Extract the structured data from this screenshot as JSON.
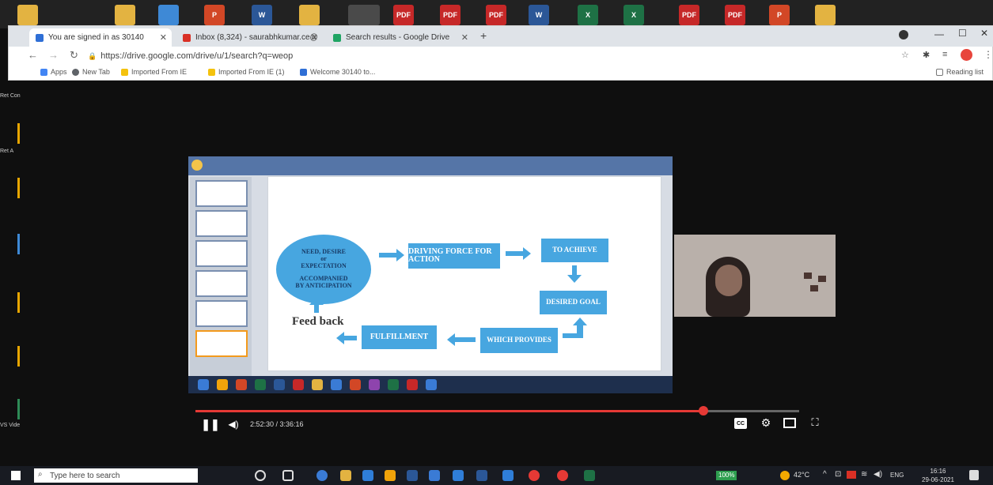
{
  "desktop": {
    "left_icons": [
      {
        "label": "Ret Con"
      },
      {
        "label": "Ret A"
      },
      {
        "label": "VS Vide"
      }
    ]
  },
  "browser": {
    "tabs": [
      {
        "title": "You are signed in as 30140",
        "favicon": "blue-square-icon",
        "color": "#2f6fd6"
      },
      {
        "title": "Inbox (8,324) - saurabhkumar.ce@",
        "favicon": "gmail-icon",
        "color": "#d93025"
      },
      {
        "title": "Search results - Google Drive",
        "favicon": "google-drive-icon",
        "color": "#1fa463"
      }
    ],
    "new_tab_label": "+",
    "url": "https://drive.google.com/drive/u/1/search?q=weop",
    "bookmarks": [
      {
        "label": "Apps",
        "color": "#4285f4"
      },
      {
        "label": "New Tab",
        "color": "#5f6368"
      },
      {
        "label": "Imported From IE",
        "color": "#f4c20d"
      },
      {
        "label": "Imported From IE (1)",
        "color": "#f4c20d"
      },
      {
        "label": "Welcome 30140 to...",
        "color": "#2f6fd6"
      }
    ],
    "reading_list": "Reading list"
  },
  "slide": {
    "oval_line1": "NEED, DESIRE",
    "oval_line2": "or",
    "oval_line3": "EXPECTATION",
    "oval_line4": "ACCOMPANIED",
    "oval_line5": "BY ANTICIPATION",
    "box_driving": "DRIVING FORCE FOR ACTION",
    "box_achieve": "TO ACHIEVE",
    "box_goal": "DESIRED GOAL",
    "box_which": "WHICH PROVIDES",
    "box_fulfillment": "FULFILLMENT",
    "feedback": "Feed back",
    "box_color": "#47a6e0"
  },
  "video": {
    "time": "2:52:30 / 3:36:16",
    "progress": 0.841,
    "accent": "#e53935"
  },
  "taskbar": {
    "search_placeholder": "Type here to search",
    "battery": "100%",
    "temperature": "42°C",
    "language": "ENG",
    "time": "16:16",
    "date": "29-06-2021"
  }
}
